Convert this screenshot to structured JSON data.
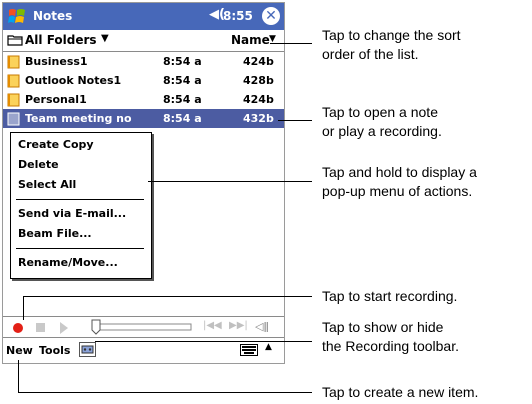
{
  "titlebar": {
    "title": "Notes",
    "speaker_icon": "speaker-icon",
    "time": "8:55",
    "close_icon": "close-icon"
  },
  "folderbar": {
    "folder": "All Folders",
    "folder_caret": "▼",
    "sort": "Name",
    "sort_caret": "▼"
  },
  "notes": [
    {
      "name": "Business1",
      "time": "8:54 a",
      "size": "424b"
    },
    {
      "name": "Outlook Notes1",
      "time": "8:54 a",
      "size": "428b"
    },
    {
      "name": "Personal1",
      "time": "8:54 a",
      "size": "424b"
    },
    {
      "name": "Team meeting no",
      "time": "8:54 a",
      "size": "432b",
      "selected": true
    }
  ],
  "popup_menu": [
    "Create Copy",
    "Delete",
    "Select All",
    "Send via E-mail...",
    "Beam File...",
    "Rename/Move..."
  ],
  "recording_toolbar": {
    "record": "record-icon",
    "stop": "stop-icon",
    "play": "play-icon",
    "skip_back": "|◀◀",
    "skip_forward": "▶▶|",
    "volume": "◁ǁ"
  },
  "menubar": {
    "new": "New",
    "tools": "Tools",
    "arrow": "▲"
  },
  "callouts": {
    "sort": [
      "Tap to change the sort",
      "order of the list."
    ],
    "open": [
      "Tap to open a note",
      "or play a recording."
    ],
    "hold": [
      "Tap and hold to display a",
      "pop-up menu of actions."
    ],
    "record": [
      "Tap to start recording."
    ],
    "toggle": [
      "Tap to show or hide",
      "the Recording toolbar."
    ],
    "new": [
      "Tap to create a new item."
    ]
  },
  "colors": {
    "titlebar": "#4768b9",
    "selection": "#4c5ca2",
    "record": "#e32016"
  }
}
